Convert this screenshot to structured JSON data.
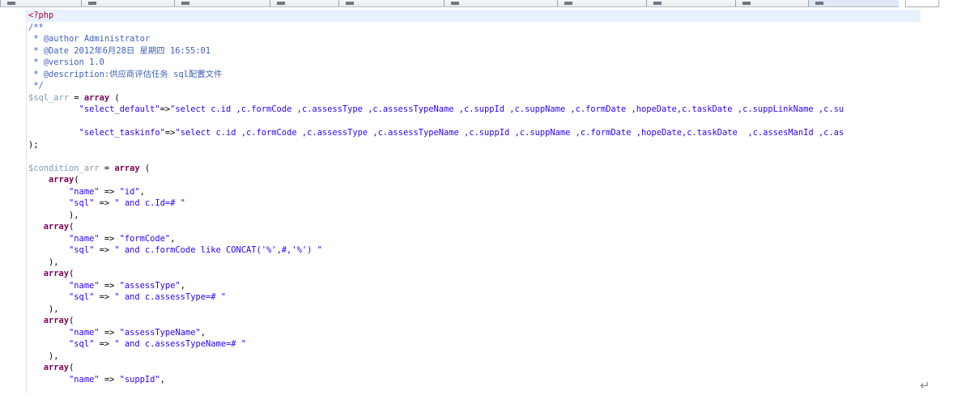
{
  "tabs": [
    {
      "name": "tab-1"
    },
    {
      "name": "tab-2"
    },
    {
      "name": "tab-3"
    },
    {
      "name": "tab-4"
    },
    {
      "name": "tab-5"
    },
    {
      "name": "tab-6"
    },
    {
      "name": "tab-7"
    },
    {
      "name": "tab-8"
    },
    {
      "name": "tab-9"
    },
    {
      "name": "tab-10"
    }
  ],
  "code": {
    "php_open": "<?php",
    "doc_start": "/**",
    "author": " * @author Administrator",
    "date": " * @Date 2012年6月28日 星期四 16:55:01",
    "version": " * @version 1.0",
    "description": " * @description:供应商评估任务 sql配置文件",
    "doc_end": " */",
    "sql_arr_var": "$sql_arr",
    "assign": " = ",
    "array_kw": "array",
    "open_paren": " (",
    "select_default_key": "\"select_default\"",
    "arrow_no_space": "=>",
    "select_default_val": "\"select c.id ,c.formCode ,c.assessType ,c.assessTypeName ,c.suppId ,c.suppName ,c.formDate ,hopeDate,c.taskDate ,c.suppLinkName ,c.su",
    "select_taskinfo_key": "\"select_taskinfo\"",
    "select_taskinfo_val": "\"select c.id ,c.formCode ,c.assessType ,c.assessTypeName ,c.suppId ,c.suppName ,c.formDate ,hopeDate,c.taskDate  ,c.assesManId ,c.as",
    "close_stmt": ");",
    "condition_arr_var": "$condition_arr",
    "paren": "(",
    "close_item": "),",
    "arrow": " => ",
    "name_key": "\"name\"",
    "sql_key": "\"sql\"",
    "comma": ",",
    "items": [
      {
        "name": "\"id\"",
        "sql": "\" and c.Id=# \""
      },
      {
        "name": "\"formCode\"",
        "sql": "\" and c.formCode like CONCAT('%',#,'%') \""
      },
      {
        "name": "\"assessType\"",
        "sql": "\" and c.assessType=# \""
      },
      {
        "name": "\"assessTypeName\"",
        "sql": "\" and c.assessTypeName=# \""
      },
      {
        "name": "\"suppId\"",
        "sql": ""
      }
    ],
    "return_symbol": "↵"
  }
}
